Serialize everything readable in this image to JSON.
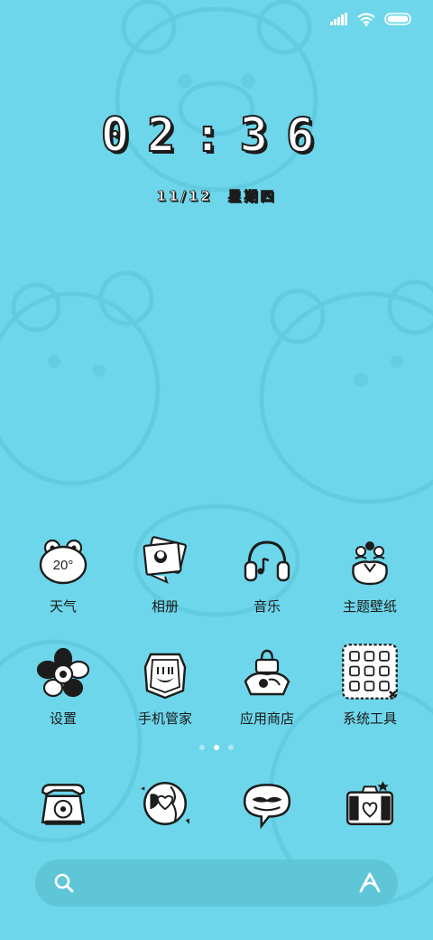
{
  "status_bar": {
    "icons": [
      "signal-icon",
      "wifi-icon",
      "battery-icon"
    ]
  },
  "clock": {
    "time": "02:36",
    "date": "11/12",
    "weekday": "星期四"
  },
  "home_apps": [
    {
      "label": "天气",
      "icon": "weather-frog-icon",
      "badge_text": "20°"
    },
    {
      "label": "相册",
      "icon": "photo-album-icon"
    },
    {
      "label": "音乐",
      "icon": "headphones-icon"
    },
    {
      "label": "主题壁纸",
      "icon": "flower-bag-icon"
    },
    {
      "label": "设置",
      "icon": "flower-gear-icon"
    },
    {
      "label": "手机管家",
      "icon": "shield-face-icon"
    },
    {
      "label": "应用商店",
      "icon": "shopping-bag-icon"
    },
    {
      "label": "系统工具",
      "icon": "folder-grid-icon"
    }
  ],
  "page_indicator": {
    "count": 3,
    "active_index": 1
  },
  "dock_apps": [
    {
      "icon": "telephone-icon"
    },
    {
      "icon": "globe-browser-icon"
    },
    {
      "icon": "message-bubble-icon"
    },
    {
      "icon": "camera-icon"
    }
  ],
  "search": {
    "placeholder": "",
    "left_icon": "search-icon",
    "right_icon": "assistant-icon"
  },
  "colors": {
    "background": "#6dd6ea",
    "search_bar": "#5fc6d8",
    "outline": "#1c1c1c",
    "text": "#1a1a1a"
  }
}
